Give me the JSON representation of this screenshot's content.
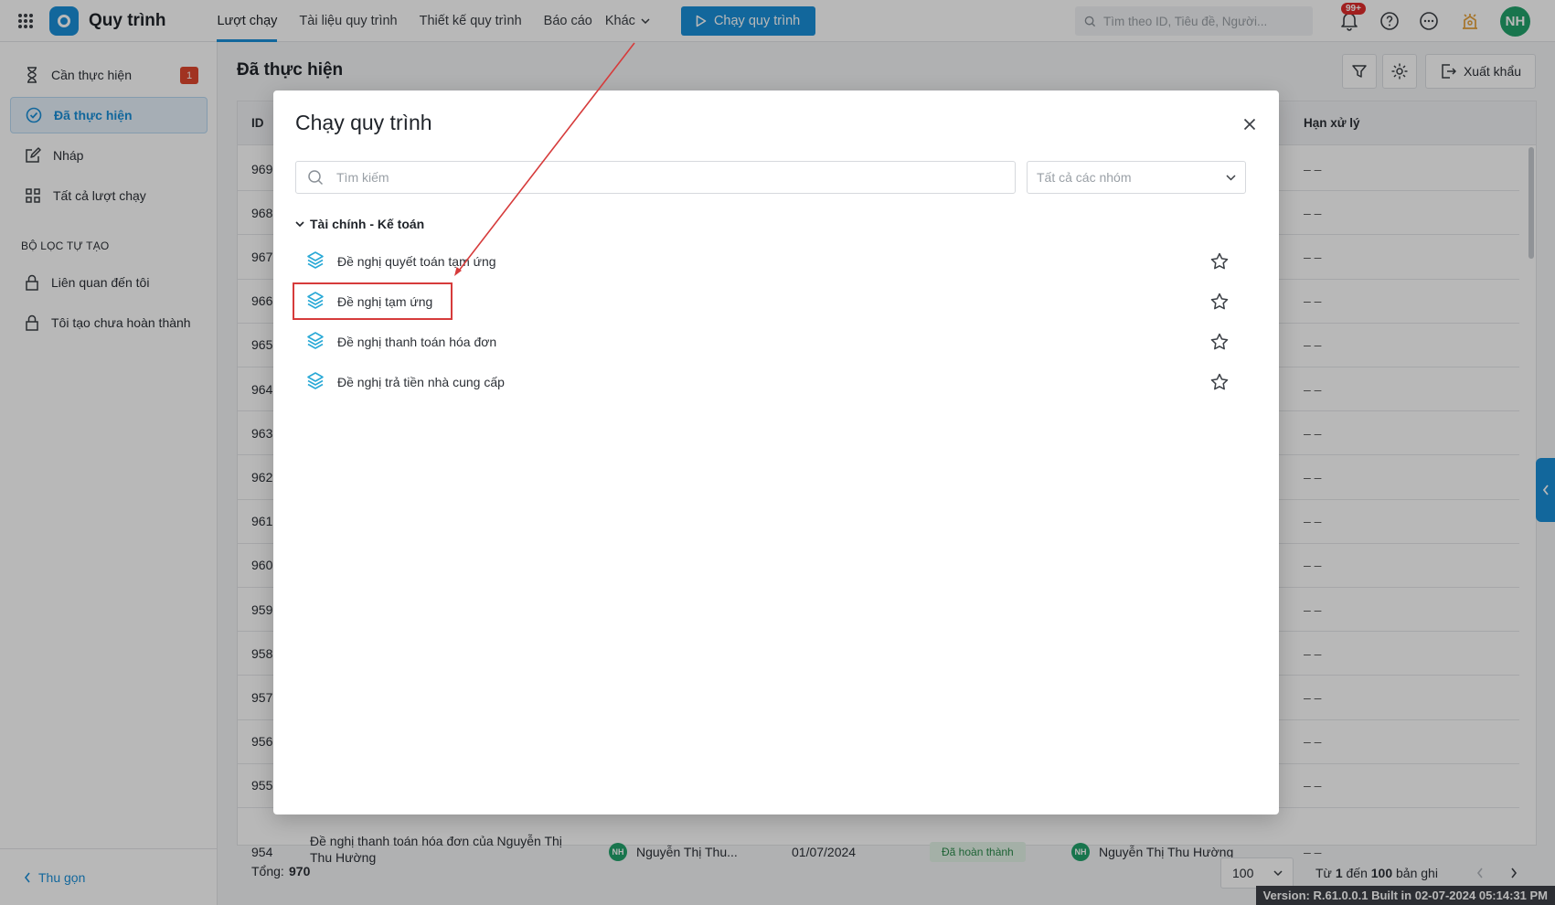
{
  "app": {
    "title": "Quy trình"
  },
  "nav": {
    "items": [
      "Lượt chạy",
      "Tài liệu quy trình",
      "Thiết kế quy trình",
      "Báo cáo",
      "Khác"
    ],
    "run_label": "Chạy quy trình"
  },
  "topbar": {
    "search_placeholder": "Tìm theo ID, Tiêu đề, Người...",
    "notif_badge": "99+",
    "avatar": "NH"
  },
  "sidebar": {
    "items": [
      {
        "label": "Cần thực hiện",
        "count": "1",
        "icon": "hourglass-icon"
      },
      {
        "label": "Đã thực hiện",
        "icon": "check-circle-icon"
      },
      {
        "label": "Nháp",
        "icon": "edit-icon"
      },
      {
        "label": "Tất cả lượt chạy",
        "icon": "grid-icon"
      }
    ],
    "custom_heading": "BỘ LỌC TỰ TẠO",
    "custom_items": [
      {
        "label": "Liên quan đến tôi",
        "icon": "lock-icon"
      },
      {
        "label": "Tôi tạo chưa hoàn thành",
        "icon": "lock-icon"
      }
    ],
    "collapse_label": "Thu gọn"
  },
  "page": {
    "title": "Đã thực hiện",
    "export_label": "Xuất khẩu"
  },
  "table": {
    "col_id": "ID",
    "col_deadline": "Hạn xử lý",
    "rows": [
      {
        "id": "969",
        "deadline": "– –"
      },
      {
        "id": "968",
        "deadline": "– –"
      },
      {
        "id": "967",
        "deadline": "– –"
      },
      {
        "id": "966",
        "deadline": "– –"
      },
      {
        "id": "965",
        "deadline": "– –"
      },
      {
        "id": "964",
        "deadline": "– –"
      },
      {
        "id": "963",
        "deadline": "– –"
      },
      {
        "id": "962",
        "deadline": "– –"
      },
      {
        "id": "961",
        "deadline": "– –"
      },
      {
        "id": "960",
        "deadline": "– –"
      },
      {
        "id": "959",
        "deadline": "– –"
      },
      {
        "id": "958",
        "deadline": "– –"
      },
      {
        "id": "957",
        "deadline": "– –"
      },
      {
        "id": "956",
        "deadline": "– –"
      },
      {
        "id": "955",
        "deadline": "– –"
      }
    ],
    "last_row": {
      "id": "954",
      "title_line1": "Đề nghị thanh toán hóa đơn của Nguyễn Thị",
      "title_line2": "Thu Hường",
      "creator_avatar": "NH",
      "creator": "Nguyễn Thị Thu...",
      "date": "01/07/2024",
      "status": "Đã hoàn thành",
      "handler_avatar": "NH",
      "handler": "Nguyễn Thị Thu Hường",
      "deadline": "– –"
    }
  },
  "footer": {
    "total_label": "Tổng:",
    "total": "970",
    "page_size": "100",
    "range_prefix": "Từ",
    "range_from": "1",
    "range_mid": "đến",
    "range_to": "100",
    "range_suffix": "bản ghi"
  },
  "version": "Version: R.61.0.0.1 Built in 02-07-2024 05:14:31 PM",
  "modal": {
    "title": "Chạy quy trình",
    "search_placeholder": "Tìm kiếm",
    "group_select": "Tất cả các nhóm",
    "group_name": "Tài chính - Kế toán",
    "processes": [
      "Đề nghị quyết toán tạm ứng",
      "Đề nghị tạm ứng",
      "Đề nghị thanh toán hóa đơn",
      "Đề nghị trả tiền nhà cung cấp"
    ]
  },
  "colors": {
    "accent": "#1a8fd8",
    "highlight": "#d63b3b",
    "status_green_bg": "#e3f4e8"
  }
}
